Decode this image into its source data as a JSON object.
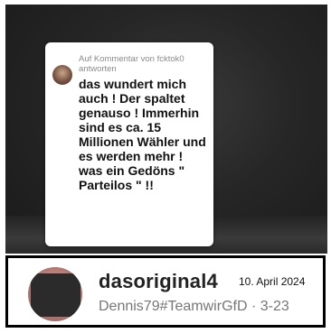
{
  "comment": {
    "reply_label": "Auf Kommentar von fcktok0 antworten",
    "text": "das wundert mich auch ! Der spaltet genauso ! Immerhin sind es ca. 15 Millionen Wähler und es werden mehr !\nwas ein Gedöns \" Parteilos \" !!"
  },
  "post": {
    "username": "dasoriginal4",
    "date": "10. April 2024",
    "subtitle": "Dennis79#TeamwirGfD · 3-23"
  }
}
